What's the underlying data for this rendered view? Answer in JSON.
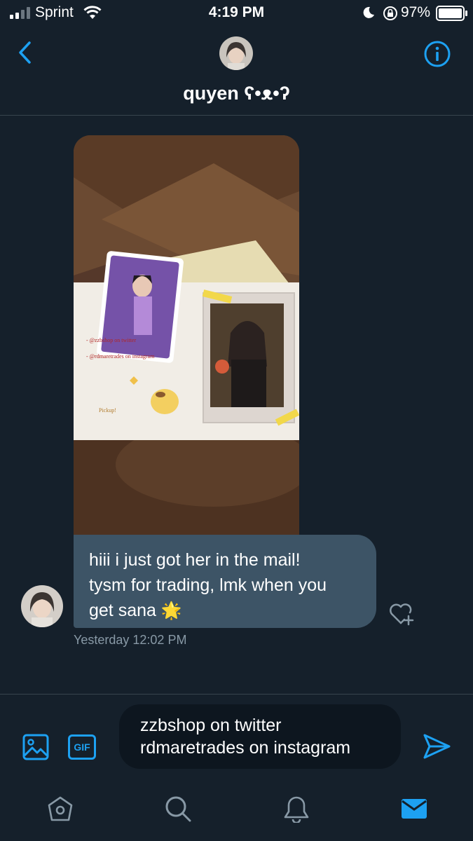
{
  "status_bar": {
    "carrier": "Sprint",
    "time": "4:19 PM",
    "battery": "97%"
  },
  "header": {
    "name": "quyen ʕ•ᴥ•ʔ",
    "back_icon": "chevron-left-icon",
    "info_icon": "info-icon"
  },
  "conversation": {
    "message_lines": [
      "hiii i just got her in the mail!",
      "tysm for trading, lmk when you",
      "get sana"
    ],
    "message_emoji": "🌟",
    "timestamp": "Yesterday 12:02 PM"
  },
  "composer": {
    "gif_label": "GIF",
    "draft_lines": [
      "zzbshop on twitter",
      "rdmaretrades on instagram"
    ]
  },
  "tabs": [
    {
      "name": "home",
      "icon": "home-icon"
    },
    {
      "name": "search",
      "icon": "search-icon"
    },
    {
      "name": "notifications",
      "icon": "bell-icon"
    },
    {
      "name": "messages",
      "icon": "mail-icon",
      "active": true
    }
  ],
  "colors": {
    "background": "#15202b",
    "accent": "#1da1f2",
    "bubble": "#3d5466",
    "secondary_text": "#8899a6"
  }
}
